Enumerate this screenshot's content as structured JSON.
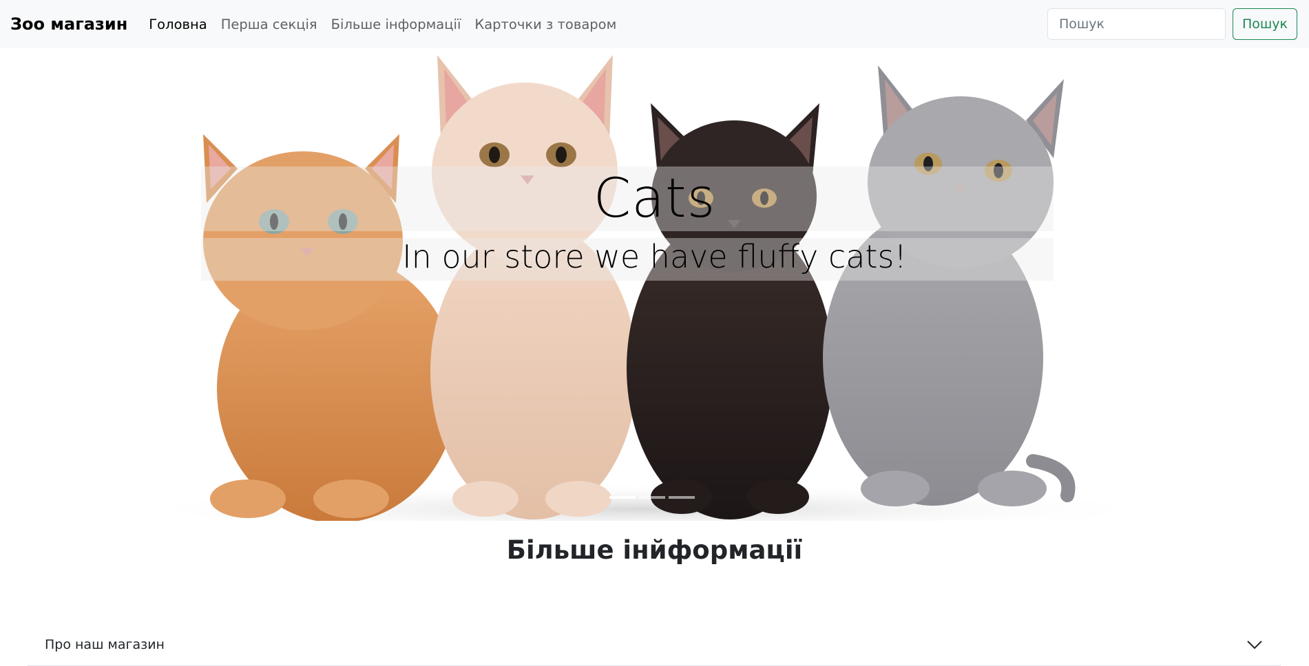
{
  "navbar": {
    "brand": "Зоо магазин",
    "links": [
      {
        "label": "Головна",
        "active": true
      },
      {
        "label": "Перша секція",
        "active": false
      },
      {
        "label": "Більше інформації",
        "active": false
      },
      {
        "label": "Карточки з товаром",
        "active": false
      }
    ],
    "search": {
      "placeholder": "Пошук",
      "value": "",
      "button_label": "Пошук"
    }
  },
  "carousel": {
    "title": "Cats",
    "subtitle": "In our store we have fluffy cats!",
    "slide_count": 3,
    "active_slide": 1
  },
  "section": {
    "title": "Більше інйформації",
    "accordion": [
      {
        "label": "Про наш магазин",
        "expanded": false
      }
    ]
  },
  "colors": {
    "navbar_bg": "#f8f9fa",
    "accent_green": "#198754"
  }
}
